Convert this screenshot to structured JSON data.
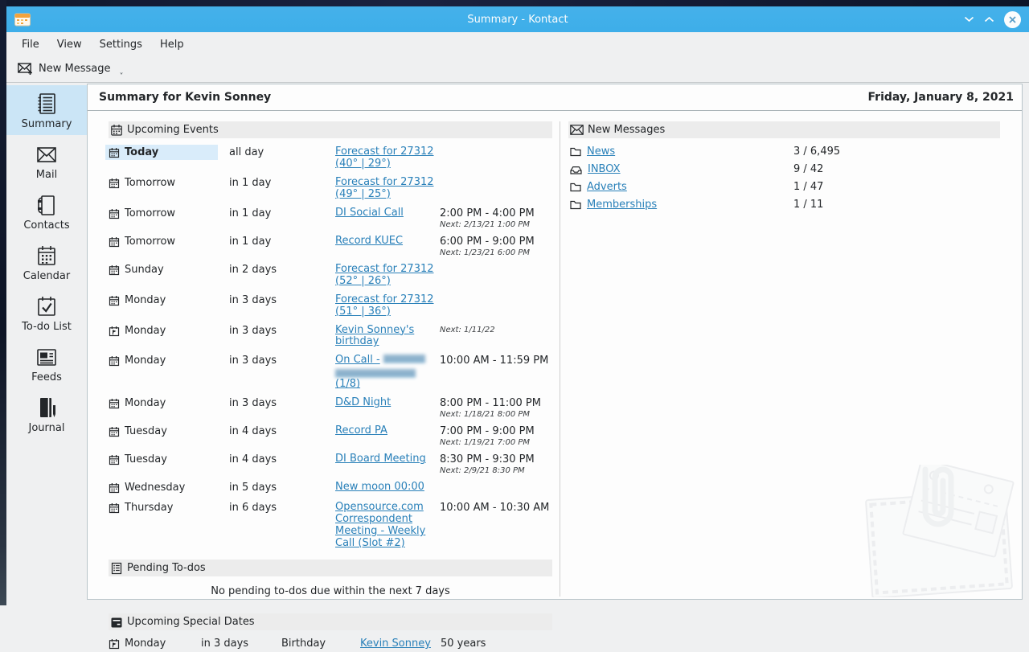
{
  "window": {
    "title": "Summary - Kontact"
  },
  "menu": {
    "items": [
      "File",
      "View",
      "Settings",
      "Help"
    ]
  },
  "toolbar": {
    "new_message_label": "New Message"
  },
  "sidebar": {
    "items": [
      {
        "label": "Summary",
        "selected": true
      },
      {
        "label": "Mail"
      },
      {
        "label": "Contacts"
      },
      {
        "label": "Calendar"
      },
      {
        "label": "To-do List"
      },
      {
        "label": "Feeds"
      },
      {
        "label": "Journal"
      }
    ]
  },
  "header": {
    "title": "Summary for Kevin Sonney",
    "date": "Friday, January 8, 2021"
  },
  "events": {
    "section_title": "Upcoming Events",
    "rows": [
      {
        "icon": "calendar-icon",
        "day": "Today",
        "bold": true,
        "highlight": true,
        "when": "all day",
        "title": "Forecast for 27312 (40° | 29°)",
        "time": "",
        "next": ""
      },
      {
        "icon": "calendar-icon",
        "day": "Tomorrow",
        "when": "in 1 day",
        "title": "Forecast for 27312 (49° | 25°)",
        "time": "",
        "next": ""
      },
      {
        "icon": "calendar-icon",
        "day": "Tomorrow",
        "when": "in 1 day",
        "title": "DI Social Call",
        "time": "2:00 PM - 4:00 PM",
        "next": "Next: 2/13/21 1:00 PM"
      },
      {
        "icon": "calendar-icon",
        "day": "Tomorrow",
        "when": "in 1 day",
        "title": "Record KUEC",
        "time": "6:00 PM - 9:00 PM",
        "next": "Next: 1/23/21 6:00 PM"
      },
      {
        "icon": "calendar-icon",
        "day": "Sunday",
        "when": "in 2 days",
        "title": "Forecast for 27312 (52° | 26°)",
        "time": "",
        "next": ""
      },
      {
        "icon": "calendar-icon",
        "day": "Monday",
        "when": "in 3 days",
        "title": "Forecast for 27312 (51° | 36°)",
        "time": "",
        "next": ""
      },
      {
        "icon": "birthday-icon",
        "day": "Monday",
        "when": "in 3 days",
        "title": "Kevin Sonney's birthday",
        "time": "",
        "next": "Next: 1/11/22"
      },
      {
        "icon": "calendar-icon",
        "day": "Monday",
        "when": "in 3 days",
        "title": "On Call -",
        "redacted": true,
        "title_suffix": "(1/8)",
        "time": "10:00 AM - 11:59 PM",
        "next": ""
      },
      {
        "icon": "calendar-icon",
        "day": "Monday",
        "when": "in 3 days",
        "title": "D&D Night",
        "time": "8:00 PM - 11:00 PM",
        "next": "Next: 1/18/21 8:00 PM"
      },
      {
        "icon": "calendar-icon",
        "day": "Tuesday",
        "when": "in 4 days",
        "title": "Record PA",
        "time": "7:00 PM - 9:00 PM",
        "next": "Next: 1/19/21 7:00 PM"
      },
      {
        "icon": "calendar-icon",
        "day": "Tuesday",
        "when": "in 4 days",
        "title": "DI Board Meeting",
        "time": "8:30 PM - 9:30 PM",
        "next": "Next: 2/9/21 8:30 PM"
      },
      {
        "icon": "calendar-icon",
        "day": "Wednesday",
        "when": "in 5 days",
        "title": "New moon 00:00",
        "time": "",
        "next": ""
      },
      {
        "icon": "calendar-icon",
        "day": "Thursday",
        "when": "in 6 days",
        "title": "Opensource.com Correspondent Meeting - Weekly Call (Slot #2)",
        "time": "10:00 AM - 10:30 AM",
        "next": ""
      }
    ]
  },
  "todos": {
    "section_title": "Pending To-dos",
    "empty_text": "No pending to-dos due within the next 7 days"
  },
  "special_dates": {
    "section_title": "Upcoming Special Dates",
    "rows": [
      {
        "icon": "birthday-icon",
        "day": "Monday",
        "when": "in 3 days",
        "type": "Birthday",
        "who": "Kevin Sonney",
        "detail": "50 years"
      }
    ]
  },
  "messages": {
    "section_title": "New Messages",
    "folders": [
      {
        "icon": "folder-icon",
        "name": "News",
        "counts": "3 / 6,495"
      },
      {
        "icon": "inbox-icon",
        "name": "INBOX",
        "counts": "9 / 42"
      },
      {
        "icon": "folder-icon",
        "name": "Adverts",
        "counts": "1 / 47"
      },
      {
        "icon": "folder-icon",
        "name": "Memberships",
        "counts": "1 / 11"
      }
    ]
  },
  "colors": {
    "titlebar": "#3daee9",
    "link": "#2980b9",
    "selected_item": "#cbe5f6",
    "today_highlight": "#d9ecfa",
    "window_bg": "#eff0f1",
    "panel_bg": "#fdfdfd"
  }
}
